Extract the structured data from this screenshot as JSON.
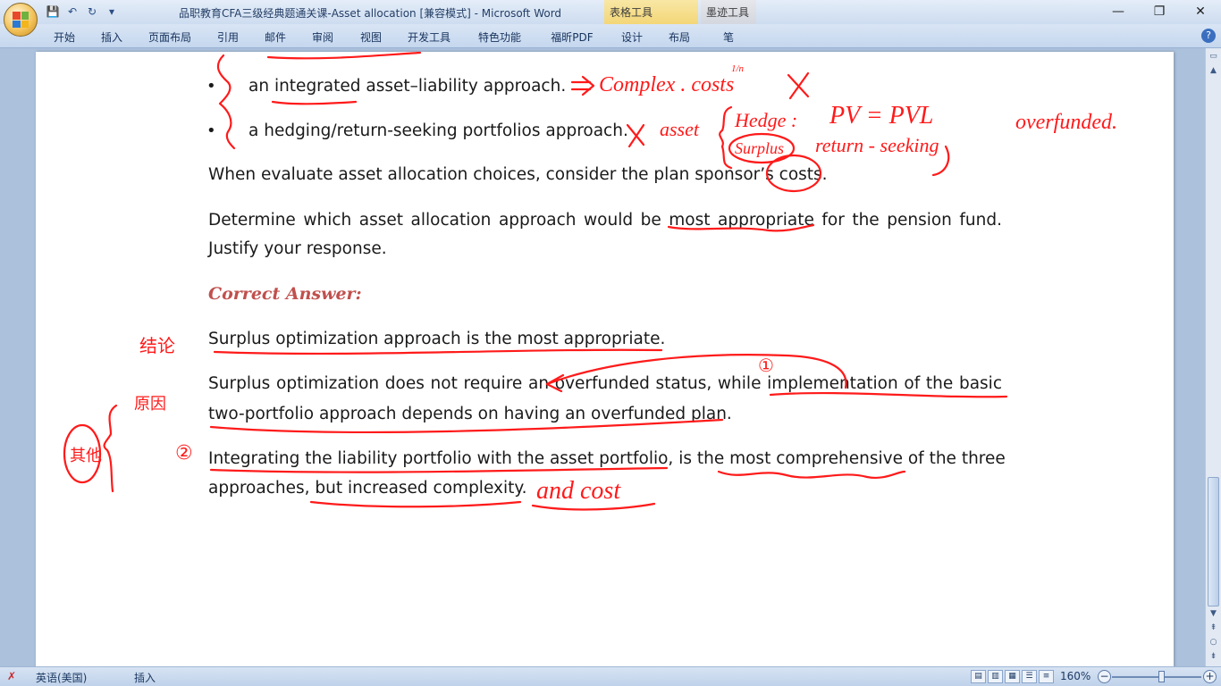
{
  "window": {
    "title": "品职教育CFA三级经典题通关课-Asset allocation [兼容模式] - Microsoft Word",
    "context_tabs": [
      "表格工具",
      "墨迹工具"
    ],
    "controls": {
      "minimize": "—",
      "maximize": "❐",
      "close": "✕"
    }
  },
  "ribbon": {
    "tabs": [
      "开始",
      "插入",
      "页面布局",
      "引用",
      "邮件",
      "审阅",
      "视图",
      "开发工具",
      "特色功能",
      "福昕PDF",
      "设计",
      "布局",
      "笔"
    ],
    "help": "?"
  },
  "qat": {
    "save": "💾",
    "undo": "↶",
    "redo": "↻",
    "more": "▾"
  },
  "document": {
    "bullet": "•",
    "bullet1": "an integrated asset–liability approach.",
    "bullet2": "a hedging/return-seeking portfolios approach.",
    "para1": "When evaluate asset allocation choices, consider the plan sponsor’s costs.",
    "para2_line1": "Determine which asset allocation approach would be most appropriate for the pension fund.",
    "para2_line2": "Justify your response.",
    "answer_heading": "Correct Answer:",
    "ans1": "Surplus optimization approach is the most appropriate.",
    "ans2_line1": "Surplus optimization does not require an overfunded status, while implementation of the basic",
    "ans2_line2": "two-portfolio approach depends on having an overfunded plan.",
    "ans3_line1": "Integrating the liability portfolio with the asset portfolio, is the most comprehensive of the three",
    "ans3_line2": "approaches, but increased complexity."
  },
  "ink_notes": {
    "complex": "Complex . costs",
    "cost_fraction": "1/n",
    "cross": "X",
    "asset": "asset",
    "hedge": "Hedge :",
    "pv": "PV = PVL",
    "surplus": "Surplus",
    "return_seeking": "return - seeking",
    "overfunded": "overfunded.",
    "conclusion": "结论",
    "reason": "原因",
    "circle1": "①",
    "circle2": "②",
    "and_cost": "and cost",
    "other": "其他"
  },
  "statusbar": {
    "language": "英语(美国)",
    "mode": "插入",
    "zoom": "160%"
  },
  "colors": {
    "ink": "#ff1a1a",
    "answer_heading": "#c0504d"
  }
}
